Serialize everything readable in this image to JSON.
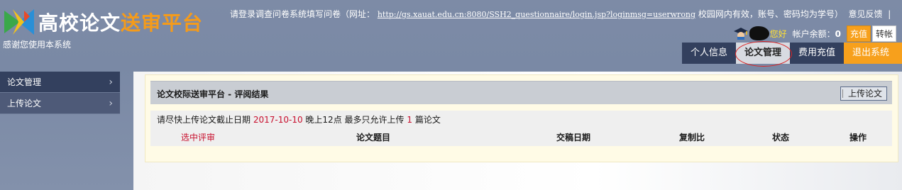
{
  "header": {
    "logo_text_white": "高校论文",
    "logo_text_orange": "送审平台",
    "thanks": "感谢您使用本系统",
    "notice_prefix": "请登录调查问卷系统填写问卷（网址：",
    "notice_url": "http://gs.xauat.edu.cn:8080/SSH2_questionnaire/login.jsp?loginmsg=userwrong",
    "notice_suffix": "校园网内有效，账号、密码均为学号）",
    "feedback": "意见反馈",
    "separator": "|"
  },
  "account": {
    "greeting": "您好",
    "balance_label": "帐户余额：",
    "balance_value": "0",
    "charge_label": "充值",
    "transfer_label": "转帐"
  },
  "nav": {
    "items": [
      {
        "label": "个人信息"
      },
      {
        "label": "论文管理"
      },
      {
        "label": "费用充值"
      },
      {
        "label": "退出系统"
      }
    ]
  },
  "sidebar": {
    "items": [
      {
        "label": "论文管理",
        "chevron": "›"
      },
      {
        "label": "上传论文",
        "chevron": "›"
      }
    ]
  },
  "main": {
    "title": "论文校际送审平台 - 评阅结果",
    "upload_button": "上传论文",
    "deadline_prefix": "请尽快上传论文截止日期",
    "deadline_date": "2017-10-10",
    "deadline_mid": "晚上12点  最多只允许上传",
    "deadline_count": "1",
    "deadline_suffix": "篇论文",
    "columns": [
      "选中评审",
      "论文题目",
      "交稿日期",
      "复制比",
      "状态",
      "操作"
    ]
  },
  "colors": {
    "nav_dark": "#33405e",
    "accent_orange": "#f7a01c",
    "highlight_red": "#c8102e"
  }
}
